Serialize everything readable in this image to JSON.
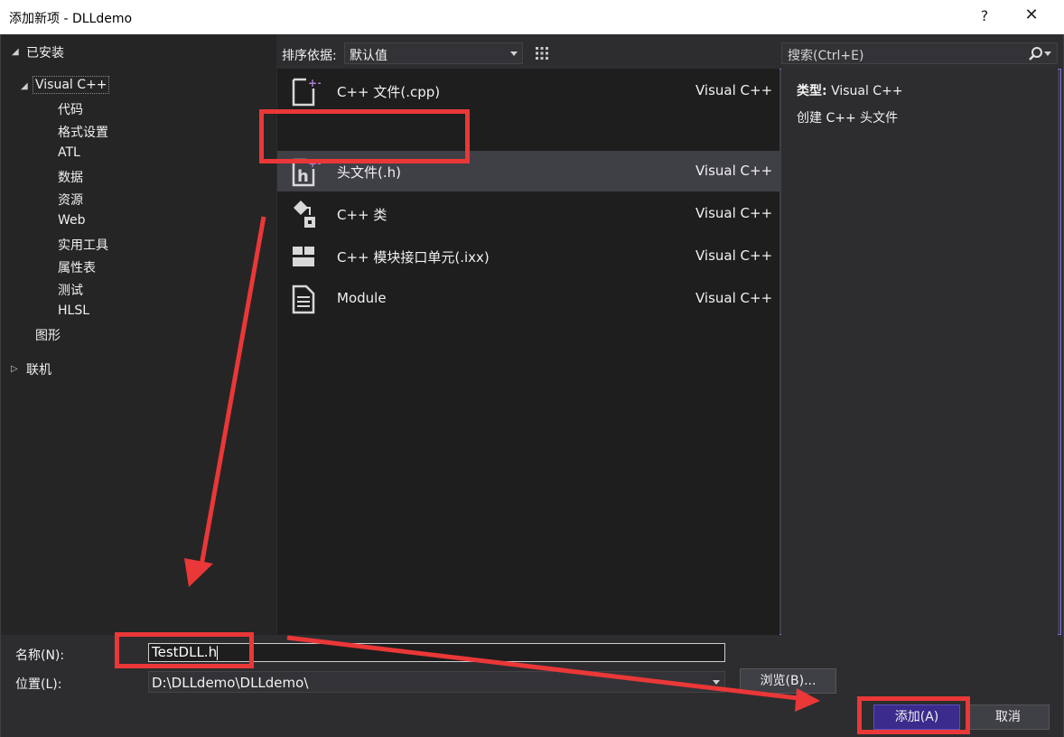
{
  "window": {
    "title": "添加新项 - DLLdemo",
    "help_label": "?",
    "close_label": "✕"
  },
  "tree": {
    "installed": "已安装",
    "visual_cpp": "Visual C++",
    "children": [
      "代码",
      "格式设置",
      "ATL",
      "数据",
      "资源",
      "Web",
      "实用工具",
      "属性表",
      "测试",
      "HLSL"
    ],
    "graphics": "图形",
    "online": "联机"
  },
  "toolbar": {
    "sort_label": "排序依据:",
    "sort_value": "默认值"
  },
  "search": {
    "placeholder": "搜索(Ctrl+E)"
  },
  "templates": [
    {
      "name": "C++ 文件(.cpp)",
      "lang": "Visual C++",
      "icon": "cpp-file-icon"
    },
    {
      "name": "头文件(.h)",
      "lang": "Visual C++",
      "icon": "header-file-icon"
    },
    {
      "name": "C++ 类",
      "lang": "Visual C++",
      "icon": "cpp-class-icon"
    },
    {
      "name": "C++ 模块接口单元(.ixx)",
      "lang": "Visual C++",
      "icon": "module-interface-icon"
    },
    {
      "name": "Module",
      "lang": "Visual C++",
      "icon": "module-icon"
    }
  ],
  "detail": {
    "type_label": "类型:",
    "type_value": "Visual C++",
    "description": "创建 C++ 头文件"
  },
  "form": {
    "name_label": "名称(N):",
    "name_value": "TestDLL.h",
    "location_label": "位置(L):",
    "location_value": "D:\\DLLdemo\\DLLdemo\\",
    "browse_label": "浏览(B)...",
    "add_label": "添加(A)",
    "cancel_label": "取消"
  },
  "colors": {
    "accent": "#7c6fd6",
    "annotation": "#ea3737",
    "add_button": "#3a2b8c"
  }
}
